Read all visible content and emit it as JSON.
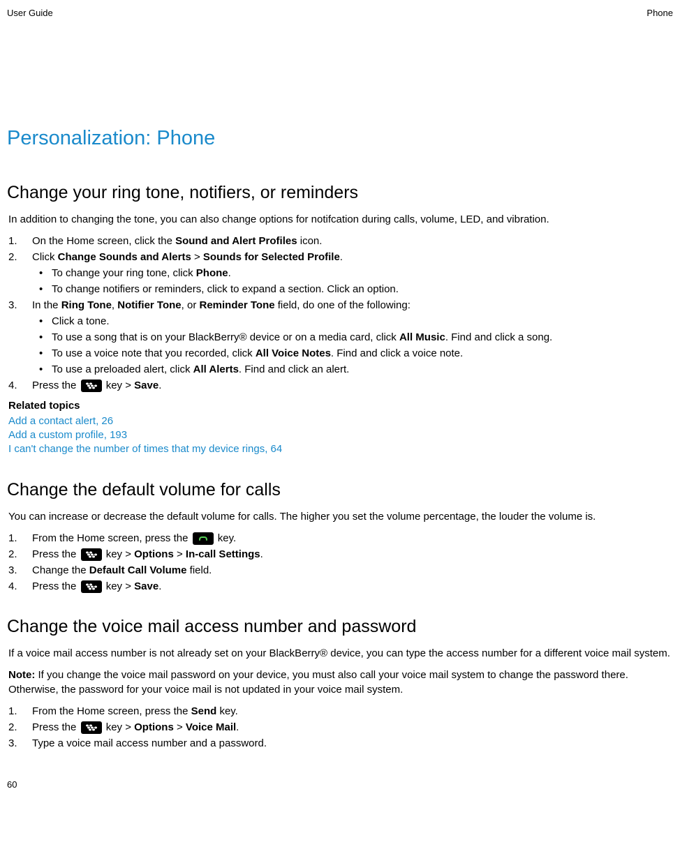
{
  "header": {
    "left": "User Guide",
    "right": "Phone"
  },
  "main_title": "Personalization: Phone",
  "s1": {
    "title": "Change your ring tone, notifiers, or reminders",
    "intro": "In addition to changing the tone, you can also change options for notifcation during calls, volume, LED, and vibration.",
    "step1_a": "On the Home screen, click the ",
    "step1_b": "Sound and Alert Profiles",
    "step1_c": " icon.",
    "step2_a": "Click ",
    "step2_b": "Change Sounds and Alerts",
    "step2_c": " > ",
    "step2_d": "Sounds for Selected Profile",
    "step2_e": ".",
    "sub2_1_a": "To change your ring tone, click ",
    "sub2_1_b": "Phone",
    "sub2_1_c": ".",
    "sub2_2": "To change notifiers or reminders, click to expand a section. Click an option.",
    "step3_a": "In the ",
    "step3_b": "Ring Tone",
    "step3_c": ", ",
    "step3_d": "Notifier Tone",
    "step3_e": ", or ",
    "step3_f": "Reminder Tone",
    "step3_g": " field, do one of the following:",
    "sub3_1": "Click a tone.",
    "sub3_2_a": "To use a song that is on your BlackBerry® device or on a media card, click ",
    "sub3_2_b": "All Music",
    "sub3_2_c": ". Find and click a song.",
    "sub3_3_a": "To use a voice note that you recorded, click ",
    "sub3_3_b": "All Voice Notes",
    "sub3_3_c": ". Find and click a voice note.",
    "sub3_4_a": "To use a preloaded alert, click ",
    "sub3_4_b": "All Alerts",
    "sub3_4_c": ". Find and click an alert.",
    "step4_a": "Press the ",
    "step4_b": " key > ",
    "step4_c": "Save",
    "step4_d": ".",
    "related_title": "Related topics",
    "rel1": "Add a contact alert, 26",
    "rel2": "Add a custom profile, 193",
    "rel3": "I can't change the number of times that my device rings, 64"
  },
  "s2": {
    "title": "Change the default volume for calls",
    "intro": "You can increase or decrease the default volume for calls. The higher you set the volume percentage, the louder the volume is.",
    "step1_a": "From the Home screen, press the ",
    "step1_b": " key.",
    "step2_a": "Press the ",
    "step2_b": " key > ",
    "step2_c": "Options",
    "step2_d": " > ",
    "step2_e": "In-call Settings",
    "step2_f": ".",
    "step3_a": "Change the ",
    "step3_b": "Default Call Volume",
    "step3_c": " field.",
    "step4_a": "Press the ",
    "step4_b": " key > ",
    "step4_c": "Save",
    "step4_d": "."
  },
  "s3": {
    "title": "Change the voice mail access number and password",
    "p1": "If a voice mail access number is not already set on your BlackBerry® device, you can type the access number for a different voice mail system.",
    "p2_a": "Note:",
    "p2_b": " If you change the voice mail password on your device, you must also call your voice mail system to change the password there. Otherwise, the password for your voice mail is not updated in your voice mail system.",
    "step1_a": "From the Home screen, press the ",
    "step1_b": "Send",
    "step1_c": " key.",
    "step2_a": "Press the ",
    "step2_b": " key > ",
    "step2_c": "Options",
    "step2_d": " > ",
    "step2_e": "Voice Mail",
    "step2_f": ".",
    "step3": "Type a voice mail access number and a password."
  },
  "footer": "60"
}
